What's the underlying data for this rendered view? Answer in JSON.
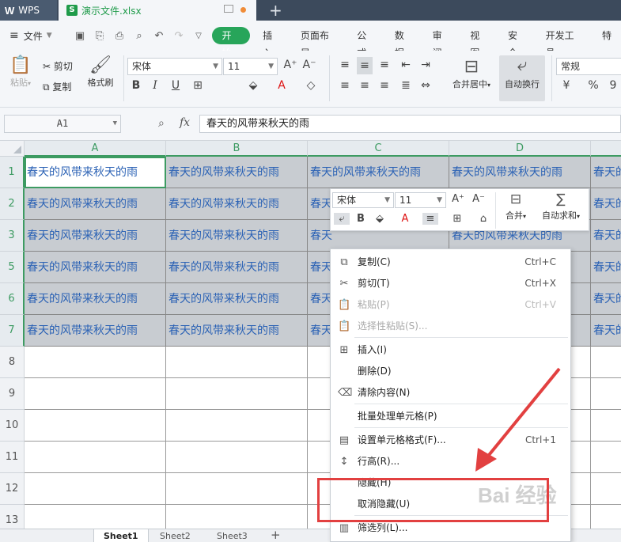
{
  "title_bar": {
    "app_tab": "WPS",
    "doc_tab": "演示文件.xlsx",
    "new_tab_icon": "plus-icon"
  },
  "menu_bar": {
    "file_label": "文件",
    "tabs": [
      "开始",
      "插入",
      "页面布局",
      "公式",
      "数据",
      "审阅",
      "视图",
      "安全",
      "开发工具",
      "特"
    ]
  },
  "ribbon": {
    "paste": "粘贴",
    "cut": "剪切",
    "copy": "复制",
    "format_painter": "格式刷",
    "font_name": "宋体",
    "font_size": "11",
    "merge_center": "合并居中",
    "wrap_text": "自动换行",
    "number_format": "常规"
  },
  "formula_bar": {
    "name_box": "A1",
    "fx_label": "fx",
    "content": "春天的风带来秋天的雨"
  },
  "grid": {
    "columns": [
      "A",
      "B",
      "C",
      "D"
    ],
    "rows": [
      "1",
      "2",
      "3",
      "5",
      "6",
      "7",
      "8",
      "9",
      "10",
      "11",
      "12",
      "13"
    ],
    "cell_text": "春天的风带来秋天的雨",
    "cell_text_partial_c": "春天",
    "cell_text_partial_e": "春天的"
  },
  "mini_toolbar": {
    "font_name": "宋体",
    "font_size": "11",
    "merge": "合并",
    "autosum": "自动求和"
  },
  "context_menu": {
    "items": [
      {
        "icon": "copy-icon",
        "label": "复制(C)",
        "shortcut": "Ctrl+C",
        "enabled": true
      },
      {
        "icon": "scissors-icon",
        "label": "剪切(T)",
        "shortcut": "Ctrl+X",
        "enabled": true
      },
      {
        "icon": "paste-icon",
        "label": "粘贴(P)",
        "shortcut": "Ctrl+V",
        "enabled": false
      },
      {
        "icon": "paste-special-icon",
        "label": "选择性粘贴(S)...",
        "shortcut": "",
        "enabled": false
      },
      {
        "icon": "insert-icon",
        "label": "插入(I)",
        "shortcut": "",
        "enabled": true
      },
      {
        "icon": "",
        "label": "删除(D)",
        "shortcut": "",
        "enabled": true
      },
      {
        "icon": "eraser-icon",
        "label": "清除内容(N)",
        "shortcut": "",
        "enabled": true
      },
      {
        "icon": "",
        "label": "批量处理单元格(P)",
        "shortcut": "",
        "enabled": true
      },
      {
        "icon": "format-cells-icon",
        "label": "设置单元格格式(F)...",
        "shortcut": "Ctrl+1",
        "enabled": true
      },
      {
        "icon": "row-height-icon",
        "label": "行高(R)...",
        "shortcut": "",
        "enabled": true
      },
      {
        "icon": "",
        "label": "隐藏(H)",
        "shortcut": "",
        "enabled": true
      },
      {
        "icon": "",
        "label": "取消隐藏(U)",
        "shortcut": "",
        "enabled": true
      },
      {
        "icon": "filter-column-icon",
        "label": "筛选列(L)...",
        "shortcut": "",
        "enabled": true
      }
    ]
  },
  "sheets": [
    "Sheet1",
    "Sheet2",
    "Sheet3"
  ],
  "watermark": "Bai 经验",
  "colors": {
    "accent_green": "#27a55a",
    "cell_text_blue": "#2b62b5",
    "highlight_red": "#e24040"
  }
}
